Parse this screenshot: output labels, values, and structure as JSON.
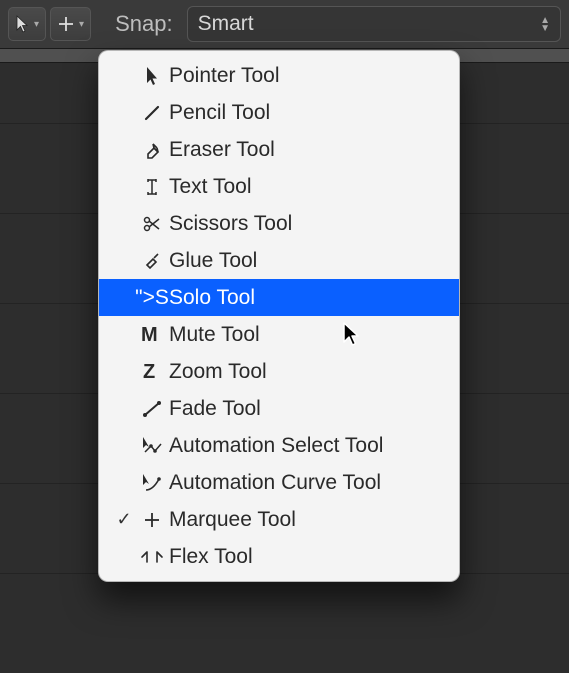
{
  "toolbar": {
    "snap_label": "Snap:",
    "snap_value": "Smart"
  },
  "menu": {
    "items": [
      {
        "label": "Pointer Tool",
        "icon": "pointer",
        "checked": false,
        "highlighted": false
      },
      {
        "label": "Pencil Tool",
        "icon": "pencil",
        "checked": false,
        "highlighted": false
      },
      {
        "label": "Eraser Tool",
        "icon": "eraser",
        "checked": false,
        "highlighted": false
      },
      {
        "label": "Text Tool",
        "icon": "text",
        "checked": false,
        "highlighted": false
      },
      {
        "label": "Scissors Tool",
        "icon": "scissors",
        "checked": false,
        "highlighted": false
      },
      {
        "label": "Glue Tool",
        "icon": "glue",
        "checked": false,
        "highlighted": false
      },
      {
        "label": "Solo Tool",
        "icon": "solo",
        "checked": false,
        "highlighted": true
      },
      {
        "label": "Mute Tool",
        "icon": "mute",
        "checked": false,
        "highlighted": false
      },
      {
        "label": "Zoom Tool",
        "icon": "zoom",
        "checked": false,
        "highlighted": false
      },
      {
        "label": "Fade Tool",
        "icon": "fade",
        "checked": false,
        "highlighted": false
      },
      {
        "label": "Automation Select Tool",
        "icon": "automation-select",
        "checked": false,
        "highlighted": false
      },
      {
        "label": "Automation Curve Tool",
        "icon": "automation-curve",
        "checked": false,
        "highlighted": false
      },
      {
        "label": "Marquee Tool",
        "icon": "marquee",
        "checked": true,
        "highlighted": false
      },
      {
        "label": "Flex Tool",
        "icon": "flex",
        "checked": false,
        "highlighted": false
      }
    ]
  },
  "icon_glyphs": {
    "solo": "S",
    "mute": "M",
    "zoom": "Z"
  }
}
